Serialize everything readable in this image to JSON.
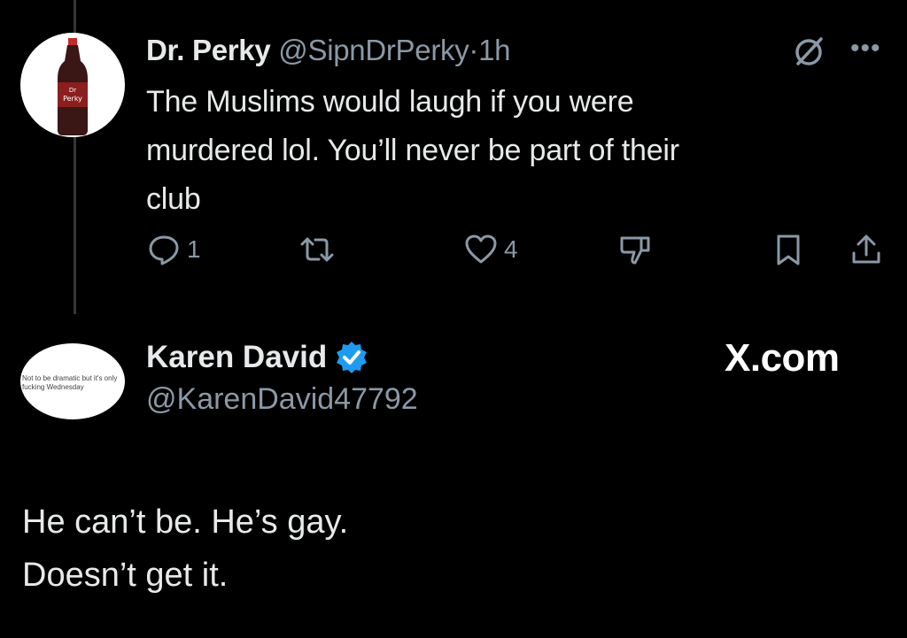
{
  "parent_tweet": {
    "display_name": "Dr. Perky",
    "handle": "@SipnDrPerky",
    "separator": "·",
    "time": "1h",
    "avatar_logo_text": "Dr Perky",
    "body_lines": [
      "The Muslims would laugh if you were",
      "murdered lol. You’ll never be part of their",
      "club"
    ],
    "actions": {
      "reply_count": "1",
      "retweet_count": "",
      "like_count": "4"
    }
  },
  "reply_tweet": {
    "display_name": "Karen David",
    "handle": "@KarenDavid47792",
    "avatar_text": "Not to be dramatic but it's only fucking Wednesday",
    "verified": true,
    "body_lines": [
      "He can’t be. He’s gay.",
      "Doesn’t get it."
    ]
  },
  "watermark": "X.com",
  "icons": [
    "grok-icon",
    "more-icon",
    "reply-icon",
    "retweet-icon",
    "like-icon",
    "dislike-icon",
    "bookmark-icon",
    "share-icon",
    "verified-badge-icon"
  ],
  "colors": {
    "background": "#000000",
    "text": "#e7e9ea",
    "muted": "#8b98a5",
    "verified": "#1d9bf0"
  }
}
